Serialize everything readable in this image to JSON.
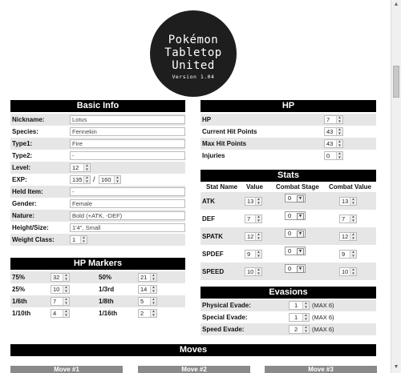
{
  "logo": {
    "line1": "Pokémon",
    "line2": "Tabletop",
    "line3": "United",
    "version": "Version 1.04"
  },
  "basic_info": {
    "title": "Basic Info",
    "nickname": {
      "label": "Nickname:",
      "value": "Lotus"
    },
    "species": {
      "label": "Species:",
      "value": "Fennekin"
    },
    "type1": {
      "label": "Type1:",
      "value": "Fire"
    },
    "type2": {
      "label": "Type2:",
      "value": "-"
    },
    "level": {
      "label": "Level:",
      "value": "12"
    },
    "exp": {
      "label": "EXP:",
      "current": "135",
      "sep": "/",
      "max": "160"
    },
    "held_item": {
      "label": "Held Item:",
      "value": "-"
    },
    "gender": {
      "label": "Gender:",
      "value": "Female"
    },
    "nature": {
      "label": "Nature:",
      "value": "Bold (+ATK, -DEF)"
    },
    "height_size": {
      "label": "Height/Size:",
      "value": "1'4\", Small"
    },
    "weight_class": {
      "label": "Weight Class:",
      "value": "1"
    }
  },
  "hp_markers": {
    "title": "HP Markers",
    "rows": [
      {
        "l1": "75%",
        "v1": "32",
        "l2": "50%",
        "v2": "21"
      },
      {
        "l1": "25%",
        "v1": "10",
        "l2": "1/3rd",
        "v2": "14"
      },
      {
        "l1": "1/6th",
        "v1": "7",
        "l2": "1/8th",
        "v2": "5"
      },
      {
        "l1": "1/10th",
        "v1": "4",
        "l2": "1/16th",
        "v2": "2"
      }
    ]
  },
  "hp": {
    "title": "HP",
    "hp": {
      "label": "HP",
      "value": "7"
    },
    "current": {
      "label": "Current Hit Points",
      "value": "43"
    },
    "max": {
      "label": "Max Hit Points",
      "value": "43"
    },
    "injuries": {
      "label": "Injuries",
      "value": "0"
    }
  },
  "stats": {
    "title": "Stats",
    "headers": {
      "name": "Stat Name",
      "value": "Value",
      "stage": "Combat Stage",
      "combat": "Combat Value"
    },
    "rows": [
      {
        "name": "ATK",
        "value": "13",
        "stage": "0",
        "combat": "13"
      },
      {
        "name": "DEF",
        "value": "7",
        "stage": "0",
        "combat": "7"
      },
      {
        "name": "SPATK",
        "value": "12",
        "stage": "0",
        "combat": "12"
      },
      {
        "name": "SPDEF",
        "value": "9",
        "stage": "0",
        "combat": "9"
      },
      {
        "name": "SPEED",
        "value": "10",
        "stage": "0",
        "combat": "10"
      }
    ]
  },
  "evasions": {
    "title": "Evasions",
    "rows": [
      {
        "label": "Physical Evade:",
        "value": "1",
        "max": "(MAX 6)"
      },
      {
        "label": "Special Evade:",
        "value": "1",
        "max": "(MAX 6)"
      },
      {
        "label": "Speed Evade:",
        "value": "2",
        "max": "(MAX 6)"
      }
    ]
  },
  "moves": {
    "title": "Moves",
    "tabs": [
      "Move #1",
      "Move #2",
      "Move #3"
    ]
  },
  "colors": {
    "header_bg": "#000000",
    "row_shade": "#e6e6e6",
    "move_bar": "#8a8a8a"
  }
}
